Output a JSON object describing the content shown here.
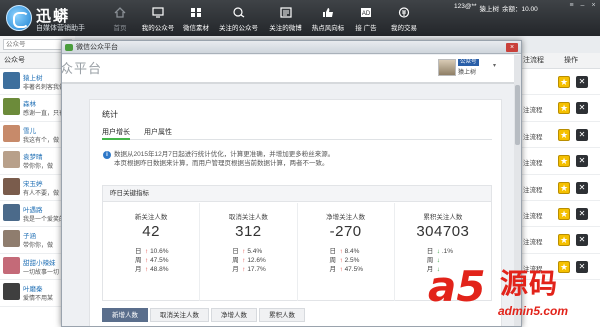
{
  "app": {
    "title": "迅蟒",
    "subtitle": "自媒体营销助手"
  },
  "nav": [
    {
      "label": "首页",
      "icon": "home-icon",
      "dim": true
    },
    {
      "label": "我的公众号",
      "icon": "monitor-icon"
    },
    {
      "label": "微信素材",
      "icon": "material-icon"
    },
    {
      "label": "关注的公众号",
      "icon": "follow-account-icon"
    },
    {
      "label": "关注的微博",
      "icon": "weibo-icon"
    },
    {
      "label": "热点风向标",
      "icon": "hot-thumb-icon"
    },
    {
      "label": "接 广告",
      "icon": "ad-icon"
    },
    {
      "label": "我的交易",
      "icon": "trade-icon"
    }
  ],
  "user": {
    "id_label": "123@**",
    "name": "猿上树",
    "balance": "余额：10.00"
  },
  "search": {
    "placeholder": "公众号"
  },
  "left_panel": {
    "header": "公众号",
    "accounts": [
      {
        "name": "猿上树",
        "snippet": "非著名刺客我做",
        "avatar": "#3d6f9d"
      },
      {
        "name": "森林",
        "snippet": "感谢一直，只有",
        "avatar": "#6c8b3a"
      },
      {
        "name": "雪儿",
        "snippet": "我这有个，做",
        "avatar": "#c78a6a"
      },
      {
        "name": "袁梦晴",
        "snippet": "带你你，做",
        "avatar": "#b8a08a"
      },
      {
        "name": "宋玉婷",
        "snippet": "有人不要，做",
        "avatar": "#7a5c4c"
      },
      {
        "name": "叶遇路",
        "snippet": "我是一个爱笑的",
        "avatar": "#4b6a8a"
      },
      {
        "name": "子涵",
        "snippet": "带你你，做",
        "avatar": "#8f7d6e"
      },
      {
        "name": "甜甜小辣妹",
        "snippet": "一切故事一切",
        "avatar": "#c46a78"
      },
      {
        "name": "叶磨秦",
        "snippet": "爱情不用某",
        "avatar": "#3f3f3f"
      }
    ]
  },
  "right_panel": {
    "col_left": "注流程",
    "col_actions": "操作",
    "row_label": "注流程",
    "rows": 8
  },
  "dialog": {
    "title": "微信公众平台",
    "close_label": "×",
    "platform_logo": "众平台",
    "account_badge": "公众号",
    "account_name": "猿上树",
    "section_title": "统计",
    "tabs": [
      "用户增长",
      "用户属性"
    ],
    "notice_lines": [
      "数据从2015年12月7日起进行统计优化，计算更准确，并增加更多粉丝来源。",
      "本页根据昨日数据来计算，而用户管理页根据当前数据计算，两者不一致。"
    ],
    "kpi_title": "昨日关键指标",
    "kpis": [
      {
        "label": "新关注人数",
        "value": "42",
        "rows": [
          {
            "key": "日",
            "dir": "up",
            "pct": "10.6%"
          },
          {
            "key": "周",
            "dir": "up",
            "pct": "47.5%"
          },
          {
            "key": "月",
            "dir": "up",
            "pct": "48.8%"
          }
        ]
      },
      {
        "label": "取消关注人数",
        "value": "312",
        "rows": [
          {
            "key": "日",
            "dir": "up",
            "pct": "5.4%"
          },
          {
            "key": "周",
            "dir": "up",
            "pct": "12.6%"
          },
          {
            "key": "月",
            "dir": "up",
            "pct": "17.7%"
          }
        ]
      },
      {
        "label": "净增关注人数",
        "value": "-270",
        "rows": [
          {
            "key": "日",
            "dir": "up",
            "pct": "8.4%"
          },
          {
            "key": "周",
            "dir": "up",
            "pct": "2.5%"
          },
          {
            "key": "月",
            "dir": "up",
            "pct": "47.5%"
          }
        ]
      },
      {
        "label": "累积关注人数",
        "value": "304703",
        "rows": [
          {
            "key": "日",
            "dir": "down",
            "pct": ".1%"
          },
          {
            "key": "周",
            "dir": "down",
            "pct": ""
          },
          {
            "key": "月",
            "dir": "down",
            "pct": ""
          }
        ]
      }
    ],
    "bottom_tabs": [
      "新增人数",
      "取消关注人数",
      "净增人数",
      "累积人数"
    ]
  },
  "watermark": {
    "brand": "a5",
    "cn": "源码",
    "url": "admin5.com"
  },
  "colors": {
    "topbar": "#2c2f33",
    "accent_green": "#44b549",
    "up": "#e0312a",
    "down": "#2d9a3a",
    "watermark": "#e2231a",
    "active_tab": "#5a6e8c"
  }
}
